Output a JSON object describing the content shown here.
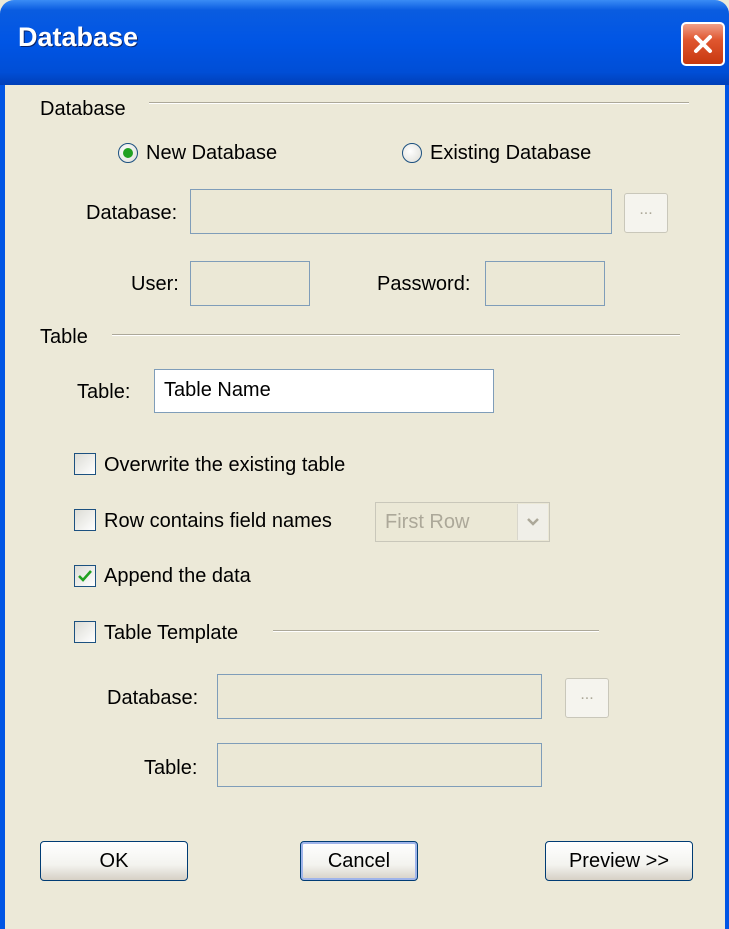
{
  "window": {
    "title": "Database"
  },
  "database_section": {
    "heading": "Database",
    "new_db_label": "New Database",
    "existing_db_label": "Existing Database",
    "database_label": "Database:",
    "database_value": "",
    "browse_label": "...",
    "user_label": "User:",
    "user_value": "",
    "password_label": "Password:",
    "password_value": ""
  },
  "table_section": {
    "heading": "Table",
    "table_label": "Table:",
    "table_value": "Table Name",
    "overwrite_label": "Overwrite the existing table",
    "row_field_names_label": "Row contains field names",
    "row_select_value": "First Row",
    "append_label": "Append the data",
    "template_label": "Table Template",
    "template_database_label": "Database:",
    "template_database_value": "",
    "template_browse_label": "...",
    "template_table_label": "Table:",
    "template_table_value": ""
  },
  "buttons": {
    "ok": "OK",
    "cancel": "Cancel",
    "preview": "Preview >>"
  },
  "state": {
    "new_database_selected": true,
    "overwrite_checked": false,
    "row_field_names_checked": false,
    "append_checked": true,
    "template_checked": false
  }
}
